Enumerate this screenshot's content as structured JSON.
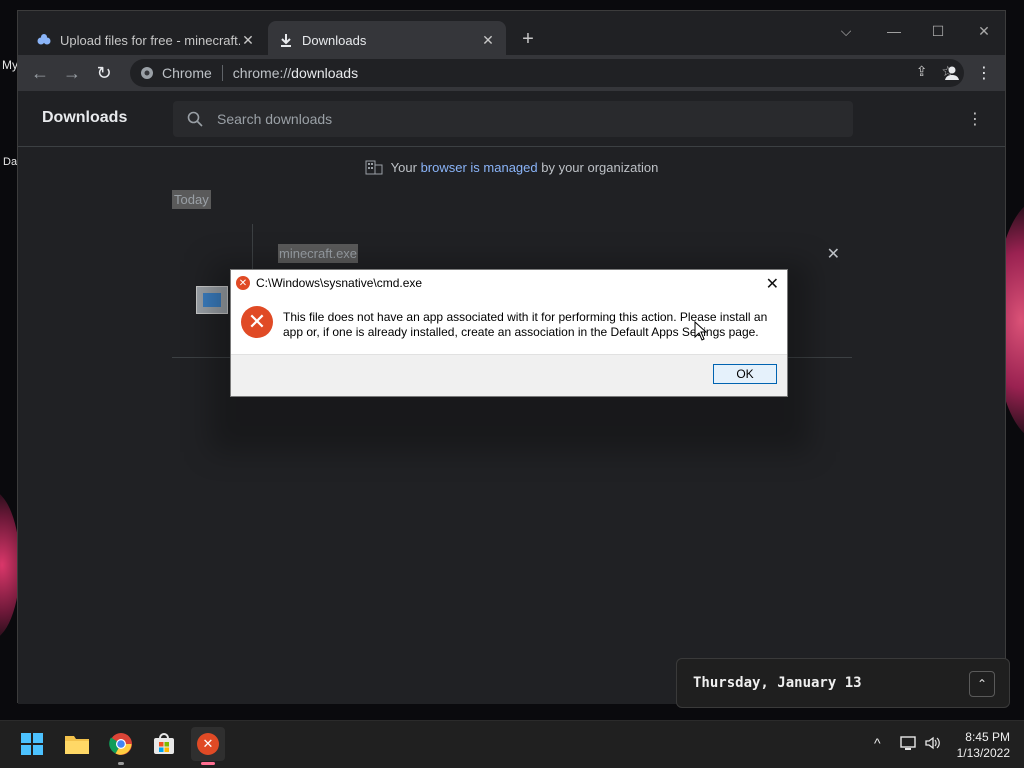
{
  "desktop": {
    "left_labels": [
      "My",
      "Da"
    ]
  },
  "browser": {
    "tabs": [
      {
        "label": "Upload files for free - minecraft.e",
        "active": false,
        "icon": "upload-site-icon"
      },
      {
        "label": "Downloads",
        "active": true,
        "icon": "download-icon"
      }
    ],
    "omnibox": {
      "chip": "Chrome",
      "url_prefix": "chrome://",
      "url_path": "downloads"
    }
  },
  "downloads_page": {
    "title": "Downloads",
    "search_placeholder": "Search downloads",
    "managed_prefix": "Your ",
    "managed_link": "browser is managed",
    "managed_suffix": " by your organization",
    "date_group": "Today",
    "items": [
      {
        "filename": "minecraft.exe"
      }
    ]
  },
  "dialog": {
    "title": "C:\\Windows\\sysnative\\cmd.exe",
    "message": "This file does not have an app associated with it for performing this action. Please install an app or, if one is already installed, create an association in the Default Apps Settings page.",
    "ok_label": "OK"
  },
  "notification": {
    "date": "Thursday, January 13"
  },
  "taskbar": {
    "apps": [
      "start-icon",
      "file-explorer-icon",
      "chrome-icon",
      "store-icon",
      "error-app-icon"
    ],
    "time": "8:45 PM",
    "date": "1/13/2022"
  },
  "colors": {
    "chrome_bg": "#202124",
    "toolbar_bg": "#35363a",
    "link": "#8ab4f8",
    "error_red": "#e04a25",
    "taskbar_bg": "#202020"
  }
}
